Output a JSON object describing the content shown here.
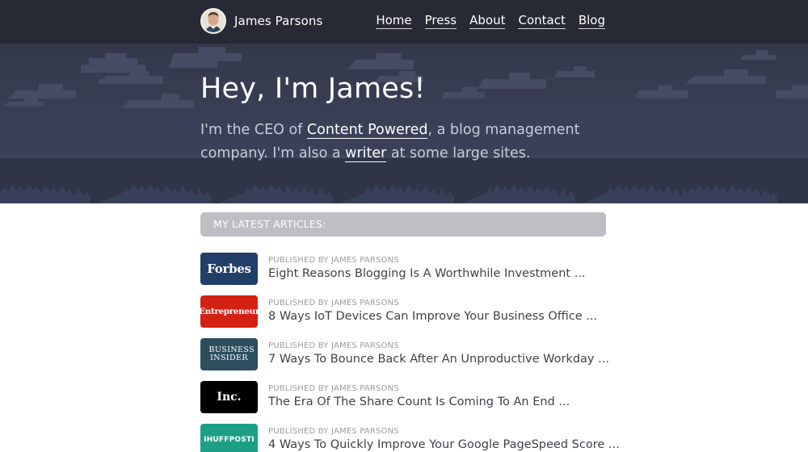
{
  "header": {
    "name": "James Parsons",
    "nav": [
      "Home",
      "Press",
      "About",
      "Contact",
      "Blog"
    ]
  },
  "hero": {
    "heading": "Hey, I'm James!",
    "intro_1": "I'm the CEO of ",
    "company_link": "Content Powered",
    "intro_2": ", a blog management company. I'm also a ",
    "writer_link": "writer",
    "intro_3": " at some large sites."
  },
  "articles": {
    "header": "MY LATEST ARTICLES:",
    "items": [
      {
        "publication": "Forbes",
        "logo_color": "#223f69",
        "byline": "PUBLISHED BY JAMES PARSONS",
        "title": "Eight Reasons Blogging Is A Worthwhile Investment ..."
      },
      {
        "publication": "Entrepreneur",
        "logo_color": "#d32114",
        "byline": "PUBLISHED BY JAMES PARSONS",
        "title": "8 Ways IoT Devices Can Improve Your Business Office ..."
      },
      {
        "publication": "BUSINESS INSIDER",
        "logo_color": "#2d4e5f",
        "byline": "PUBLISHED BY JAMES PARSONS",
        "title": "7 Ways To Bounce Back After An Unproductive Workday ..."
      },
      {
        "publication": "Inc.",
        "logo_color": "#000000",
        "byline": "PUBLISHED BY JAMES PARSONS",
        "title": "The Era Of The Share Count Is Coming To An End ..."
      },
      {
        "publication": "IHUFFPOSTI",
        "logo_color": "#1c9f84",
        "byline": "PUBLISHED BY JAMES PARSONS",
        "title": "4 Ways To Quickly Improve Your Google PageSpeed Score ..."
      }
    ]
  },
  "colors": {
    "topbar": "#272a35",
    "hero": "#3b4058",
    "section_header": "#bdbfc4"
  }
}
